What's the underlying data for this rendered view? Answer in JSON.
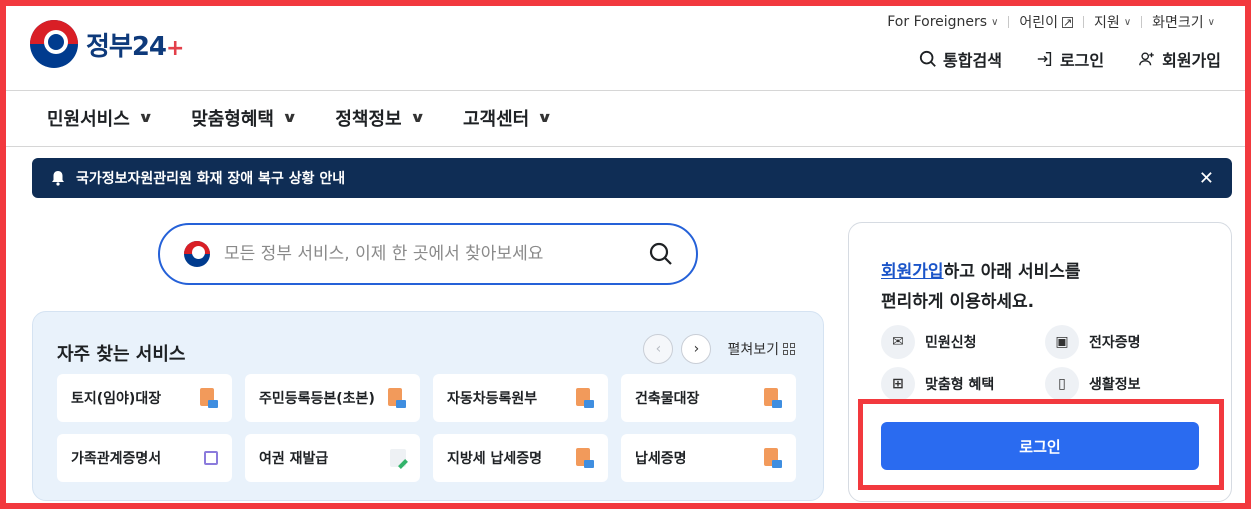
{
  "logo": {
    "text": "정부",
    "number": "24",
    "plus": "+"
  },
  "util": {
    "foreigners": "For Foreigners",
    "kids": "어린이",
    "support": "지원",
    "screen_size": "화면크기"
  },
  "header_links": {
    "search": "통합검색",
    "login": "로그인",
    "signup": "회원가입"
  },
  "gnb": [
    {
      "label": "민원서비스"
    },
    {
      "label": "맞춤형혜택"
    },
    {
      "label": "정책정보"
    },
    {
      "label": "고객센터"
    }
  ],
  "banner": {
    "text": "국가정보자원관리원 화재 장애 복구 상황 안내",
    "close": "✕"
  },
  "search": {
    "placeholder": "모든 정부 서비스, 이제 한 곳에서 찾아보세요"
  },
  "frequent": {
    "title": "자주 찾는 서비스",
    "expand": "펼쳐보기",
    "cards": [
      {
        "label": "토지(임야)대장",
        "icon": "document-icon"
      },
      {
        "label": "주민등록등본(초본)",
        "icon": "document-icon"
      },
      {
        "label": "자동차등록원부",
        "icon": "document-icon"
      },
      {
        "label": "건축물대장",
        "icon": "document-icon"
      },
      {
        "label": "가족관계증명서",
        "icon": "external-link-icon"
      },
      {
        "label": "여권 재발급",
        "icon": "edit-icon"
      },
      {
        "label": "지방세 납세증명",
        "icon": "document-icon"
      },
      {
        "label": "납세증명",
        "icon": "document-icon"
      }
    ]
  },
  "side": {
    "msg_link": "회원가입",
    "msg_rest1": "하고 아래 서비스를",
    "msg_line2": "편리하게 이용하세요.",
    "services": [
      {
        "label": "민원신청",
        "icon": "envelope-icon"
      },
      {
        "label": "전자증명",
        "icon": "certificate-icon"
      },
      {
        "label": "맞춤형 혜택",
        "icon": "gift-icon"
      },
      {
        "label": "생활정보",
        "icon": "bookmark-icon"
      }
    ],
    "login_button": "로그인"
  },
  "colors": {
    "accent": "#2a6bf0",
    "banner": "#0f2d55",
    "highlight": "#f2393e"
  }
}
